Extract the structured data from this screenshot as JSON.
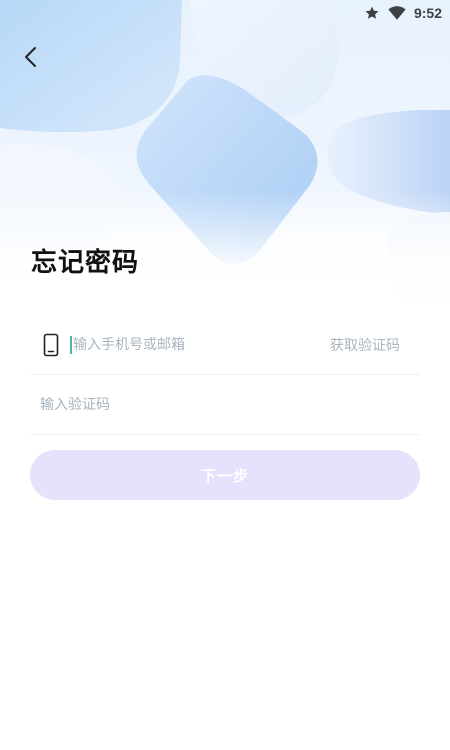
{
  "status_bar": {
    "time": "9:52",
    "icons": [
      "star-icon",
      "wifi-icon"
    ]
  },
  "header": {
    "back_icon": "chevron-left-icon",
    "title": "忘记密码"
  },
  "form": {
    "phone": {
      "icon": "phone-icon",
      "value": "",
      "placeholder": "输入手机号或邮箱"
    },
    "get_code_label": "获取验证码",
    "code": {
      "value": "",
      "placeholder": "输入验证码"
    },
    "next_label": "下一步"
  },
  "colors": {
    "accent": "#e6e2fb",
    "placeholder": "#a8b4c0",
    "caret": "#4fb3a6",
    "title": "#111111"
  }
}
